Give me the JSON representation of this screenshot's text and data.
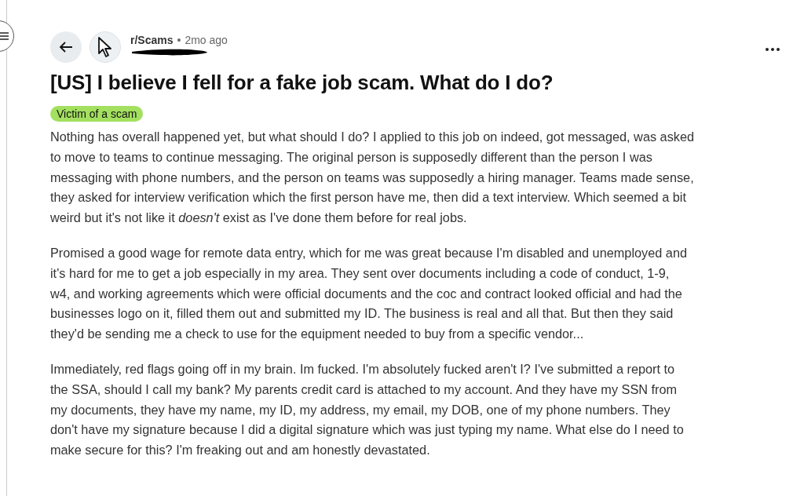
{
  "post": {
    "subreddit": "r/Scams",
    "separator": "•",
    "age": "2mo ago",
    "title": "[US] I believe I fell for a fake job scam. What do I do?",
    "flair": {
      "label": "Victim of a scam",
      "color": "#a3e05f"
    },
    "paragraphs": [
      {
        "lines": [
          "Nothing has overall happened yet, but what should I do? I applied to this job on indeed, got messaged, was asked",
          "to move to teams to continue messaging. The original person is supposedly different than the person I was",
          "messaging with phone numbers, and the person on teams was supposedly a hiring manager. Teams made sense,",
          "they asked for interview verification which the first person have me, then did a text interview. Which seemed a bit",
          "weird but it's not like it *doesn't* exist as I've done them before for real jobs."
        ]
      },
      {
        "lines": [
          "Promised a good wage for remote data entry, which for me was great because I'm disabled and unemployed and",
          "it's hard for me to get a job especially in my area. They sent over documents including a code of conduct, 1-9,",
          "w4, and working agreements which were official documents and the coc and contract looked official and had the",
          "businesses logo on it, filled them out and submitted my ID. The business is real and all that. But then they said",
          "they'd be sending me a check to use for the equipment needed to buy from a specific vendor..."
        ]
      },
      {
        "lines": [
          "Immediately, red flags going off in my brain. Im fucked. I'm absolutely fucked aren't I? I've submitted a report to",
          "the SSA, should I call my bank? My parents credit card is attached to my account. And they have my SSN from",
          "my documents, they have my name, my ID, my address, my email, my DOB, one of my phone numbers. They",
          "don't have my signature because I did a digital signature which was just typing my name. What else do I need to",
          "make secure for this? I'm freaking out and am honestly devastated."
        ]
      }
    ]
  }
}
